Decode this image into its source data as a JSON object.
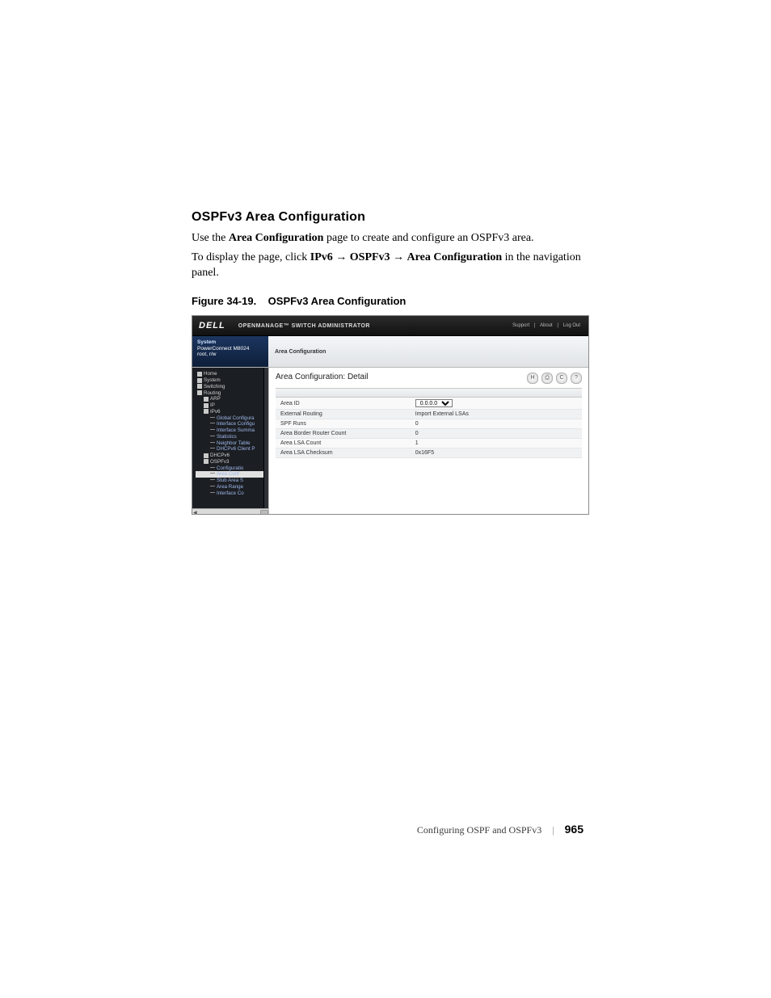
{
  "section_heading": "OSPFv3 Area Configuration",
  "intro_prefix": "Use the ",
  "intro_bold": "Area Configuration",
  "intro_suffix": " page to create and configure an OSPFv3 area.",
  "nav_prefix": "To display the page, click ",
  "nav_b1": "IPv6",
  "nav_b2": "OSPFv3",
  "nav_b3": "Area Configuration",
  "nav_suffix": " in the navigation panel.",
  "figure_caption_ref": "Figure 34-19.",
  "figure_caption_title": "OSPFv3 Area Configuration",
  "screenshot": {
    "brand": "DELL",
    "product": "OPENMANAGE™ SWITCH ADMINISTRATOR",
    "top_links": [
      "Support",
      "About",
      "Log Out"
    ],
    "sys": {
      "title": "System",
      "device": "PowerConnect M8024",
      "user": "root, r/w"
    },
    "breadcrumb": "Area Configuration",
    "sidebar": {
      "items": [
        {
          "label": "Home"
        },
        {
          "label": "System"
        },
        {
          "label": "Switching"
        },
        {
          "label": "Routing"
        },
        {
          "label": "ARP",
          "indent": 1
        },
        {
          "label": "IP",
          "indent": 1
        },
        {
          "label": "IPv6",
          "indent": 1
        },
        {
          "label": "Global Configura",
          "indent": 2,
          "leaf": true
        },
        {
          "label": "Interface Configu",
          "indent": 2,
          "leaf": true
        },
        {
          "label": "Interface Summa",
          "indent": 2,
          "leaf": true
        },
        {
          "label": "Statistics",
          "indent": 2,
          "leaf": true
        },
        {
          "label": "Neighbor Table",
          "indent": 2,
          "leaf": true
        },
        {
          "label": "DHCPv6 Client P",
          "indent": 2,
          "leaf": true
        },
        {
          "label": "DHCPv6",
          "indent": 1
        },
        {
          "label": "OSPFv3",
          "indent": 1
        },
        {
          "label": "Configuratio",
          "indent": 2,
          "leaf": true
        },
        {
          "label": "Area Conf",
          "indent": 2,
          "leaf": true,
          "hi": true
        },
        {
          "label": "Stub Area S",
          "indent": 2,
          "leaf": true
        },
        {
          "label": "Area Range",
          "indent": 2,
          "leaf": true
        },
        {
          "label": "Interface Co",
          "indent": 2,
          "leaf": true
        }
      ]
    },
    "panel_title": "Area Configuration: Detail",
    "toolbar_icons": {
      "save": "H",
      "print": "⎙",
      "refresh": "C",
      "help": "?"
    },
    "rows": [
      {
        "k": "Area ID",
        "v_select": "0.0.0.0"
      },
      {
        "k": "External Routing",
        "v": "Import External LSAs"
      },
      {
        "k": "SPF Runs",
        "v": "0"
      },
      {
        "k": "Area Border Router Count",
        "v": "0"
      },
      {
        "k": "Area LSA Count",
        "v": "1"
      },
      {
        "k": "Area LSA Checksum",
        "v": "0x16F5"
      }
    ]
  },
  "footer": {
    "chapter": "Configuring OSPF and OSPFv3",
    "page": "965"
  }
}
